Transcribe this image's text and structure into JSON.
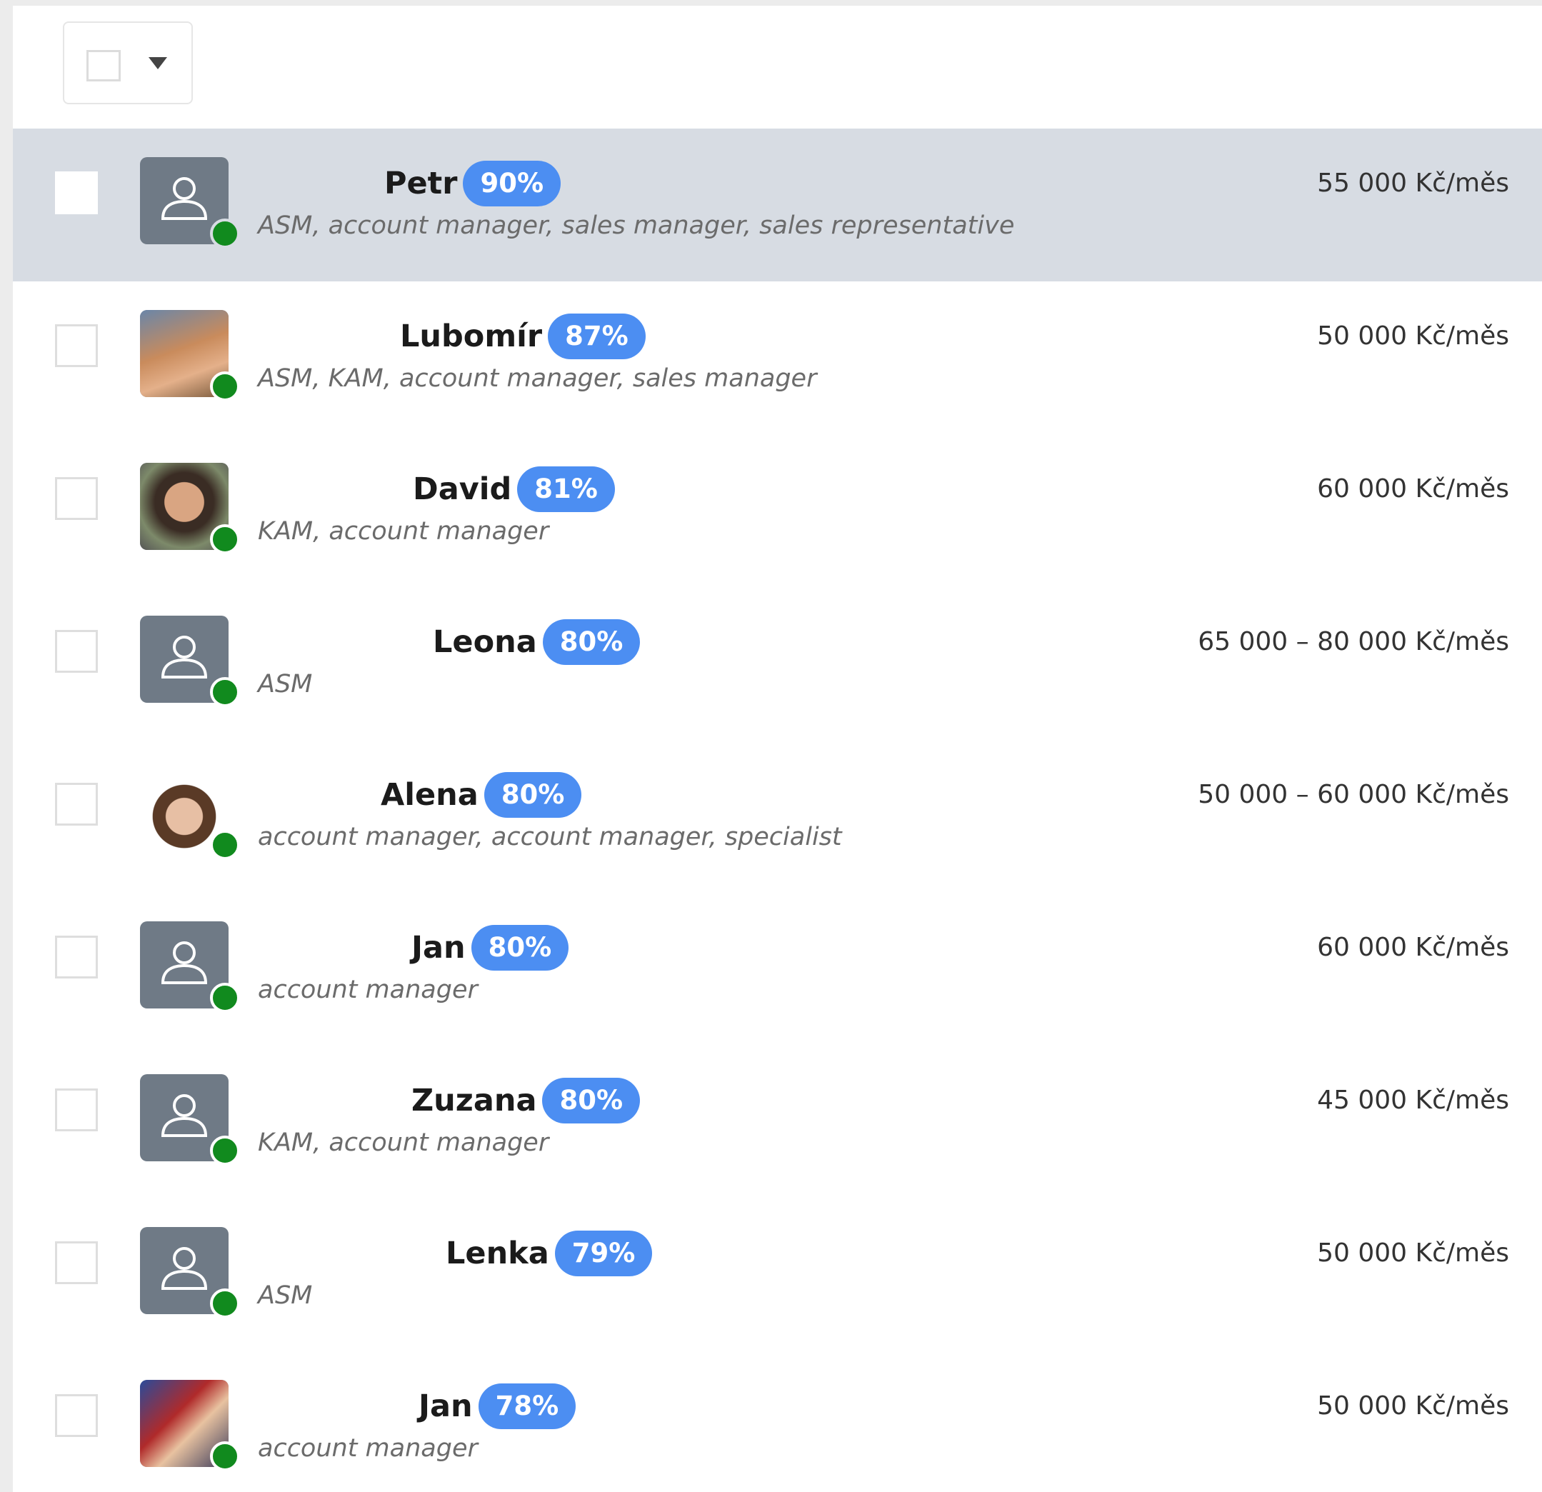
{
  "toolbar": {
    "bulk_select_icon": "checkbox-dropdown"
  },
  "candidates": [
    {
      "name": "Petr",
      "match": "90%",
      "roles": "ASM, account manager, sales manager, sales representative",
      "salary": "55 000 Kč/měs",
      "online": true,
      "selected": true,
      "avatar": "placeholder"
    },
    {
      "name": "Lubomír",
      "match": "87%",
      "roles": "ASM, KAM, account manager, sales manager",
      "salary": "50 000 Kč/měs",
      "online": true,
      "selected": false,
      "avatar": "photo"
    },
    {
      "name": "David",
      "match": "81%",
      "roles": "KAM, account manager",
      "salary": "60 000 Kč/měs",
      "online": true,
      "selected": false,
      "avatar": "photo"
    },
    {
      "name": "Leona",
      "match": "80%",
      "roles": "ASM",
      "salary": "65 000 – 80 000 Kč/měs",
      "online": true,
      "selected": false,
      "avatar": "placeholder"
    },
    {
      "name": "Alena",
      "match": "80%",
      "roles": "account manager, account manager, specialist",
      "salary": "50 000 – 60 000 Kč/měs",
      "online": true,
      "selected": false,
      "avatar": "photo"
    },
    {
      "name": "Jan",
      "match": "80%",
      "roles": "account manager",
      "salary": "60 000 Kč/měs",
      "online": true,
      "selected": false,
      "avatar": "placeholder"
    },
    {
      "name": "Zuzana",
      "match": "80%",
      "roles": "KAM, account manager",
      "salary": "45 000 Kč/měs",
      "online": true,
      "selected": false,
      "avatar": "placeholder"
    },
    {
      "name": "Lenka",
      "match": "79%",
      "roles": "ASM",
      "salary": "50 000 Kč/měs",
      "online": true,
      "selected": false,
      "avatar": "placeholder"
    },
    {
      "name": "Jan",
      "match": "78%",
      "roles": "account manager",
      "salary": "50 000 Kč/měs",
      "online": true,
      "selected": false,
      "avatar": "photo"
    }
  ]
}
